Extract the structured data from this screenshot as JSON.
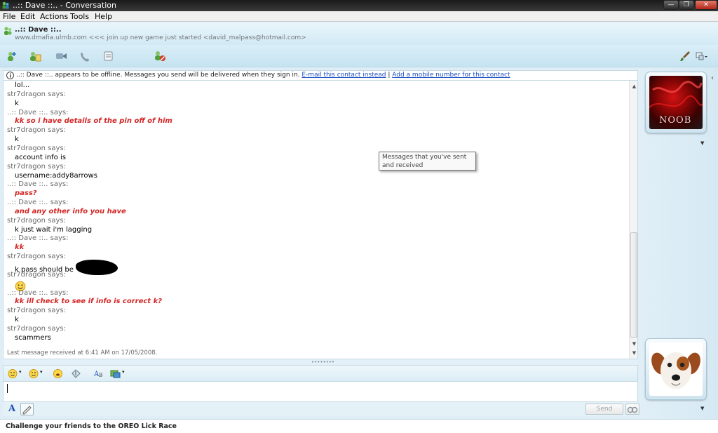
{
  "window": {
    "title": "..:: Dave ::.. - Conversation",
    "minimize_glyph": "—",
    "maximize_glyph": "❐",
    "close_glyph": "✕"
  },
  "menu": [
    "File",
    "Edit",
    "Actions",
    "Tools",
    "Help"
  ],
  "contact": {
    "name": "..:: Dave ::..",
    "personal_message": "www.dmafia.ulmb.com <<< join up new game just started <david_malpass@hotmail.com>"
  },
  "toolbar_icons": [
    "invite-icon",
    "send-files-icon",
    "video-icon",
    "call-icon",
    "activities-icon",
    "block-icon",
    "paint-brush-icon",
    "display-options-icon"
  ],
  "info_bar": {
    "text": "..:: Dave ::.. appears to be offline. Messages you send will be delivered when they sign in.",
    "email_link": "E-mail this contact instead",
    "separator": "|",
    "mobile_link": "Add a mobile number for this contact"
  },
  "messages": [
    {
      "kind": "text",
      "text": "lol..."
    },
    {
      "kind": "sender",
      "text": "str7dragon says:"
    },
    {
      "kind": "text",
      "text": "k"
    },
    {
      "kind": "sender",
      "text": "..:: Dave ::.. says:"
    },
    {
      "kind": "red",
      "text": "kk so i have details of the pin off of him"
    },
    {
      "kind": "sender",
      "text": "str7dragon says:"
    },
    {
      "kind": "text",
      "text": "k"
    },
    {
      "kind": "sender",
      "text": "str7dragon says:"
    },
    {
      "kind": "text",
      "text": "account info is"
    },
    {
      "kind": "sender",
      "text": "str7dragon says:"
    },
    {
      "kind": "text",
      "text": "username:addy8arrows"
    },
    {
      "kind": "sender",
      "text": "..:: Dave ::.. says:"
    },
    {
      "kind": "red",
      "text": "pass?"
    },
    {
      "kind": "sender",
      "text": "..:: Dave ::.. says:"
    },
    {
      "kind": "red",
      "text": "and any other info you have"
    },
    {
      "kind": "sender",
      "text": "str7dragon says:"
    },
    {
      "kind": "text",
      "text": "k just wait i'm lagging"
    },
    {
      "kind": "sender",
      "text": "..:: Dave ::.. says:"
    },
    {
      "kind": "red",
      "text": "kk"
    },
    {
      "kind": "sender",
      "text": "str7dragon says:"
    },
    {
      "kind": "text",
      "text": "k pass should be",
      "redacted": true
    },
    {
      "kind": "sender",
      "text": "str7dragon says:"
    },
    {
      "kind": "emoticon",
      "text": "",
      "icon": "smiley-icon"
    },
    {
      "kind": "sender",
      "text": "..:: Dave ::.. says:"
    },
    {
      "kind": "red",
      "text": "kk ill check to see if info is correct k?"
    },
    {
      "kind": "sender",
      "text": "str7dragon says:"
    },
    {
      "kind": "text",
      "text": "k"
    },
    {
      "kind": "sender",
      "text": "str7dragon says:"
    },
    {
      "kind": "text",
      "text": "scammers"
    }
  ],
  "status_line": "Last message received at 6:41 AM on 17/05/2008.",
  "tooltip": "Messages that you've sent and received",
  "format_icons": [
    "emoticon-icon",
    "wink-icon",
    "voice-clip-icon",
    "nudge-icon",
    "font-style-icon",
    "background-icon"
  ],
  "input": {
    "value": "",
    "placeholder": ""
  },
  "send_label": "Send",
  "ad_text": "Challenge your friends to the OREO Lick Race",
  "contact_picture_text": "NOOB",
  "colors": {
    "sender": "#6b6b6b",
    "dave_text": "#d42626",
    "link": "#1a4fc4"
  }
}
